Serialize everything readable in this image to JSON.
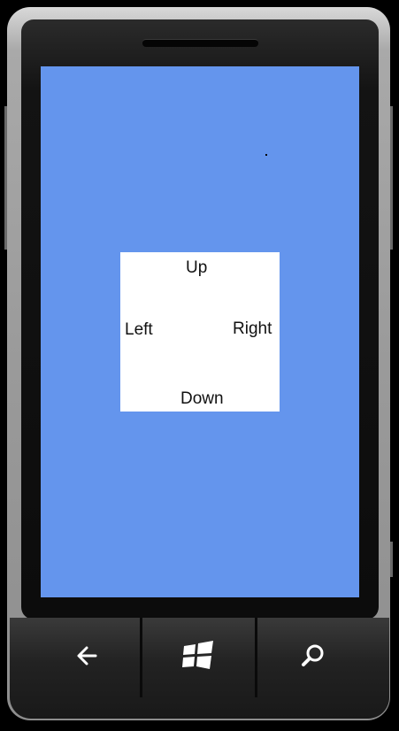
{
  "screen": {
    "background": "#6495ed"
  },
  "dpad": {
    "up_label": "Up",
    "left_label": "Left",
    "right_label": "Right",
    "down_label": "Down"
  },
  "hardware_buttons": {
    "back_icon": "arrow-left-icon",
    "start_icon": "windows-logo-icon",
    "search_icon": "search-icon"
  }
}
